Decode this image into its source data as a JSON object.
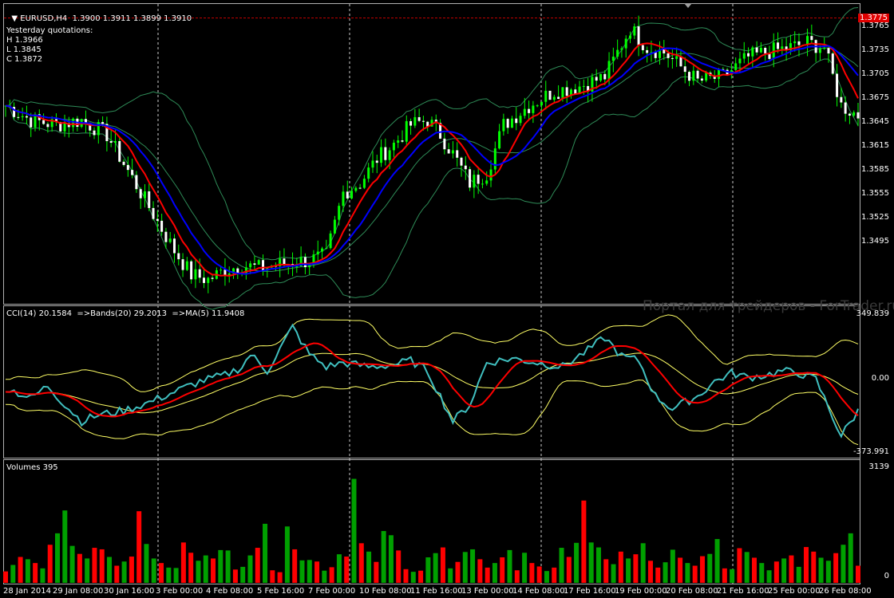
{
  "main_panel": {
    "symbol": "EURUSD,H4",
    "ohlc": "1.3900 1.3911 1.3899 1.3910",
    "yesterday_title": "Yesterday quotations:",
    "yesterday_high": "H 1.3966",
    "yesterday_low": "L 1.3845",
    "yesterday_close": "C 1.3872",
    "current_price": "1.3775",
    "y_ticks": [
      "1.3765",
      "1.3735",
      "1.3705",
      "1.3675",
      "1.3645",
      "1.3615",
      "1.3585",
      "1.3555",
      "1.3525",
      "1.3495"
    ]
  },
  "cci_panel": {
    "label": "CCI(14) 20.1584  =>Bands(20) 29.2013  =>MA(5) 11.9408",
    "y_ticks": [
      "349.839",
      "0.00",
      "-373.991"
    ]
  },
  "volume_panel": {
    "label": "Volumes 395",
    "y_ticks": [
      "3139",
      "0"
    ]
  },
  "x_labels": [
    "28 Jan 2014",
    "29 Jan 08:00",
    "30 Jan 16:00",
    "3 Feb 00:00",
    "4 Feb 08:00",
    "5 Feb 16:00",
    "7 Feb 00:00",
    "10 Feb 08:00",
    "11 Feb 16:00",
    "13 Feb 00:00",
    "14 Feb 08:00",
    "17 Feb 16:00",
    "19 Feb 00:00",
    "20 Feb 08:00",
    "21 Feb 16:00",
    "25 Feb 00:00",
    "26 Feb 08:00"
  ],
  "watermark": "Портал для трейдеров - ForTrader.ru",
  "colors": {
    "background": "#000000",
    "candle_up": "#00ff00",
    "candle_down": "#ffffff",
    "ma_fast": "#ff0000",
    "ma_slow": "#0000ff",
    "bollinger": "#2e8b57",
    "cci_line": "#40c0c0",
    "cci_ma": "#ff0000",
    "cci_bands": "#ffff66",
    "volume_up": "#00a000",
    "volume_down": "#ff0000"
  },
  "chart_data": {
    "type": "candlestick",
    "price_ylim": [
      1.3475,
      1.3785
    ],
    "cci_ylim": [
      -373.991,
      349.839
    ],
    "volume_ylim": [
      0,
      3139
    ],
    "volume_scale_note": "",
    "price_anchors": [
      [
        0,
        1.368
      ],
      [
        6,
        1.3665
      ],
      [
        12,
        1.366
      ],
      [
        18,
        1.3665
      ],
      [
        24,
        1.365
      ],
      [
        28,
        1.362
      ],
      [
        32,
        1.359
      ],
      [
        36,
        1.356
      ],
      [
        40,
        1.353
      ],
      [
        44,
        1.3505
      ],
      [
        48,
        1.35
      ],
      [
        52,
        1.351
      ],
      [
        56,
        1.3515
      ],
      [
        60,
        1.3512
      ],
      [
        64,
        1.3515
      ],
      [
        68,
        1.3518
      ],
      [
        72,
        1.352
      ],
      [
        76,
        1.3525
      ],
      [
        80,
        1.359
      ],
      [
        84,
        1.36
      ],
      [
        88,
        1.3625
      ],
      [
        92,
        1.364
      ],
      [
        96,
        1.366
      ],
      [
        100,
        1.3665
      ],
      [
        103,
        1.365
      ],
      [
        106,
        1.363
      ],
      [
        110,
        1.36
      ],
      [
        114,
        1.361
      ],
      [
        118,
        1.366
      ],
      [
        124,
        1.368
      ],
      [
        130,
        1.3695
      ],
      [
        136,
        1.37
      ],
      [
        142,
        1.371
      ],
      [
        148,
        1.376
      ],
      [
        152,
        1.374
      ],
      [
        156,
        1.3735
      ],
      [
        160,
        1.372
      ],
      [
        164,
        1.3705
      ],
      [
        170,
        1.371
      ],
      [
        176,
        1.373
      ],
      [
        180,
        1.3735
      ],
      [
        186,
        1.374
      ],
      [
        190,
        1.3745
      ],
      [
        194,
        1.374
      ],
      [
        198,
        1.368
      ],
      [
        202,
        1.367
      ]
    ],
    "cci_anchors": [
      [
        0,
        -40
      ],
      [
        6,
        -90
      ],
      [
        10,
        -30
      ],
      [
        14,
        -120
      ],
      [
        18,
        -200
      ],
      [
        22,
        -170
      ],
      [
        28,
        -150
      ],
      [
        34,
        -110
      ],
      [
        40,
        -60
      ],
      [
        46,
        -10
      ],
      [
        52,
        20
      ],
      [
        56,
        60
      ],
      [
        58,
        120
      ],
      [
        62,
        40
      ],
      [
        66,
        180
      ],
      [
        68,
        250
      ],
      [
        72,
        120
      ],
      [
        76,
        60
      ],
      [
        80,
        80
      ],
      [
        86,
        60
      ],
      [
        92,
        70
      ],
      [
        96,
        90
      ],
      [
        100,
        40
      ],
      [
        104,
        -120
      ],
      [
        106,
        -200
      ],
      [
        110,
        -120
      ],
      [
        114,
        80
      ],
      [
        120,
        100
      ],
      [
        126,
        80
      ],
      [
        132,
        60
      ],
      [
        138,
        140
      ],
      [
        142,
        200
      ],
      [
        146,
        110
      ],
      [
        150,
        90
      ],
      [
        154,
        -80
      ],
      [
        158,
        -140
      ],
      [
        164,
        -80
      ],
      [
        168,
        -10
      ],
      [
        172,
        30
      ],
      [
        176,
        10
      ],
      [
        180,
        20
      ],
      [
        184,
        40
      ],
      [
        188,
        30
      ],
      [
        192,
        0
      ],
      [
        196,
        -180
      ],
      [
        198,
        -270
      ],
      [
        202,
        -150
      ]
    ],
    "volume_values": [
      300,
      470,
      680,
      620,
      520,
      380,
      1000,
      1300,
      1900,
      970,
      760,
      640,
      920,
      880,
      680,
      450,
      560,
      690,
      1880,
      1020,
      640,
      520,
      400,
      390,
      1060,
      790,
      580,
      720,
      640,
      860,
      850,
      350,
      420,
      720,
      920,
      1550,
      330,
      280,
      1480,
      880,
      590,
      600,
      560,
      320,
      410,
      750,
      690,
      2730,
      1040,
      820,
      550,
      1360,
      1250,
      850,
      360,
      290,
      320,
      670,
      780,
      930,
      380,
      550,
      810,
      880,
      620,
      400,
      520,
      670,
      860,
      330,
      790,
      520,
      430,
      310,
      400,
      920,
      680,
      1050,
      2160,
      1060,
      930,
      620,
      490,
      820,
      640,
      750,
      1040,
      580,
      400,
      540,
      870,
      660,
      520,
      450,
      700,
      760,
      1150,
      380,
      360,
      910,
      810,
      660,
      520,
      330,
      560,
      640,
      720,
      420,
      940,
      820,
      660,
      580,
      780,
      1000,
      1300,
      450
    ],
    "volume_down_flags": [
      1,
      0,
      1,
      0,
      1,
      0,
      1,
      0,
      0,
      0,
      1,
      0,
      1,
      1,
      0,
      1,
      0,
      1,
      1,
      0,
      0,
      1,
      0,
      0,
      1,
      1,
      0,
      0,
      1,
      0,
      0,
      1,
      0,
      0,
      1,
      0,
      1,
      1,
      0,
      1,
      0,
      0,
      1,
      0,
      1,
      0,
      1,
      0,
      1,
      0,
      1,
      0,
      0,
      1,
      1,
      0,
      1,
      0,
      0,
      1,
      0,
      1,
      0,
      0,
      1,
      1,
      0,
      1,
      0,
      1,
      0,
      1,
      1,
      0,
      1,
      0,
      1,
      0,
      1,
      0,
      0,
      1,
      0,
      1,
      0,
      1,
      0,
      1,
      1,
      0,
      0,
      1,
      0,
      1,
      1,
      0,
      0,
      1,
      0,
      1,
      0,
      1,
      0,
      0,
      1,
      0,
      1,
      0,
      1,
      1,
      0,
      0,
      1,
      0,
      0,
      1,
      0
    ],
    "x_labels": [
      "28 Jan 2014",
      "29 Jan 08:00",
      "30 Jan 16:00",
      "3 Feb 00:00",
      "4 Feb 08:00",
      "5 Feb 16:00",
      "7 Feb 00:00",
      "10 Feb 08:00",
      "11 Feb 16:00",
      "13 Feb 00:00",
      "14 Feb 08:00",
      "17 Feb 16:00",
      "19 Feb 00:00",
      "20 Feb 08:00",
      "21 Feb 16:00",
      "25 Feb 00:00",
      "26 Feb 08:00"
    ]
  }
}
